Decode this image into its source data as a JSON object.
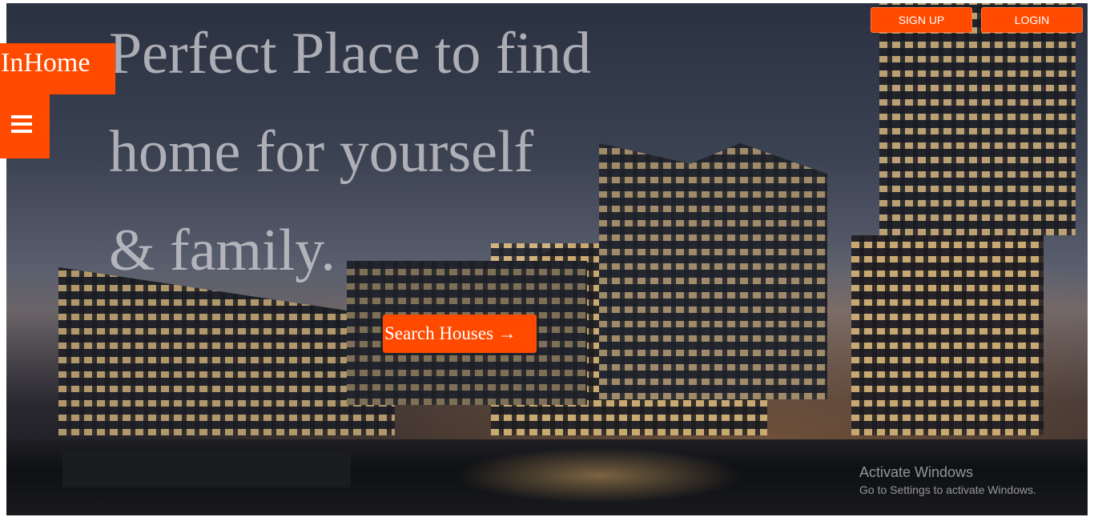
{
  "brand": {
    "logo_text": "InHome"
  },
  "nav": {
    "menu_icon": "hamburger-menu-icon"
  },
  "auth": {
    "signup_label": "SIGN UP",
    "login_label": "LOGIN"
  },
  "hero": {
    "headline_lines": [
      "Perfect Place to find",
      "home for yourself",
      "& family."
    ],
    "cta_label": "Search Houses →"
  },
  "watermark": {
    "title": "Activate Windows",
    "subtitle": "Go to Settings to activate Windows."
  },
  "colors": {
    "accent": "#ff4a00",
    "headline": "#c8c8cd"
  }
}
